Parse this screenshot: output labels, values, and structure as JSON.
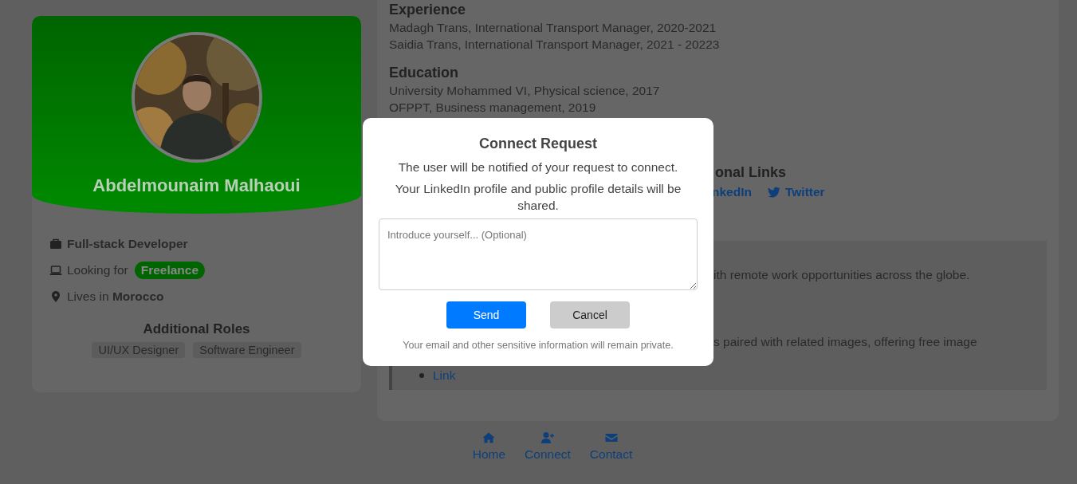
{
  "profile_card": {
    "name": "Abdelmounaim Malhaoui",
    "details": [
      {
        "kind": "job",
        "text": "Full-stack Developer"
      },
      {
        "kind": "looking",
        "text": "Looking for",
        "badge": "Freelance"
      },
      {
        "kind": "location",
        "text": "Lives in **Morocco**"
      }
    ],
    "additional_roles": {
      "title": "Additional Roles",
      "tags": [
        "UI/UX Designer",
        "Software Engineer"
      ]
    }
  },
  "main": {
    "sections": [
      {
        "title": "Experience",
        "lines": [
          "Madagh Trans, International Transport Manager, 2020-2021",
          "Saidia Trans, International Transport Manager, 2021 - 20223"
        ]
      },
      {
        "title": "Education",
        "lines": [
          "University Mohammed VI, Physical science, 2017",
          "OFPPT, Business management, 2019"
        ]
      }
    ],
    "links": {
      "title": "onal Links",
      "items": [
        {
          "kind": "linkedin",
          "label": "nkedIn"
        },
        {
          "kind": "twitter",
          "label": "Twitter"
        }
      ]
    },
    "note": {
      "paragraph": "ith remote work opportunities across the globe.",
      "list_text": "s paired with related images, offering free image",
      "link": "Link"
    }
  },
  "modal": {
    "title": "Connect Request",
    "lines": [
      "The user will be notified of your request to connect.",
      "Your LinkedIn profile and public profile details will be shared."
    ],
    "placeholder": "Introduce yourself... (Optional)",
    "buttons": [
      {
        "kind": "primary",
        "label": "Send"
      },
      {
        "kind": "secondary",
        "label": "Cancel"
      }
    ],
    "footnote": "Your email and other sensitive information will remain private."
  },
  "bottom_nav": [
    {
      "kind": "home",
      "label": "Home"
    },
    {
      "kind": "connect",
      "label": "Connect"
    },
    {
      "kind": "contact",
      "label": "Contact"
    }
  ]
}
